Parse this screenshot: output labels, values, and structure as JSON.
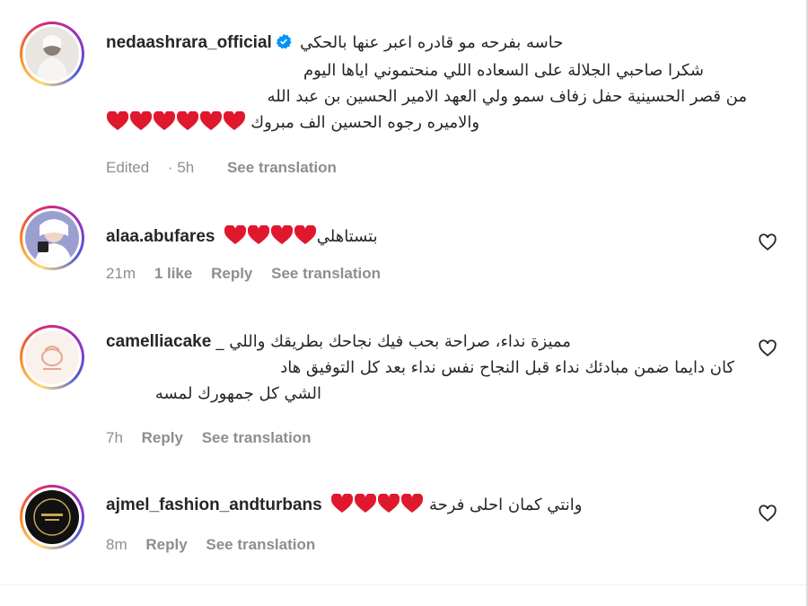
{
  "post": {
    "username": "nedaashrara_official",
    "caption_lines": [
      "حاسه بفرحه مو قادره اعبر عنها بالحكي",
      "شكرا صاحبي الجلالة على السعاده اللي منحتموني اياها اليوم",
      "من قصر الحسينية حفل زفاف سمو ولي العهد الامير الحسين بن عبد الله",
      "والاميره رجوه الحسين الف مبروك"
    ],
    "edited": "Edited",
    "time": "5h",
    "see_translation": "See translation"
  },
  "comments": [
    {
      "username": "alaa.abufares",
      "text": "بتستاهلي",
      "time": "21m",
      "likes": "1 like",
      "reply": "Reply",
      "see_translation": "See translation"
    },
    {
      "username": "camelliacake",
      "lines": [
        "مميزة نداء، صراحة بحب فيك نجاحك بطريقك واللي _",
        "كان دايما ضمن مبادئك نداء قبل النجاح نفس نداء بعد كل التوفيق هاد",
        "الشي كل جمهورك لمسه"
      ],
      "time": "7h",
      "reply": "Reply",
      "see_translation": "See translation"
    },
    {
      "username": "ajmel_fashion_andturbans",
      "text": "وانتي كمان احلى فرحة",
      "time": "8m",
      "reply": "Reply",
      "see_translation": "See translation"
    }
  ],
  "icons": {
    "verified": "verified-badge-icon",
    "like": "heart-outline-icon",
    "emoji": "red-heart-emoji"
  },
  "colors": {
    "text": "#262626",
    "secondary": "#8e8e8e",
    "verified": "#0095f6",
    "heart_emoji": "#e0182d"
  }
}
